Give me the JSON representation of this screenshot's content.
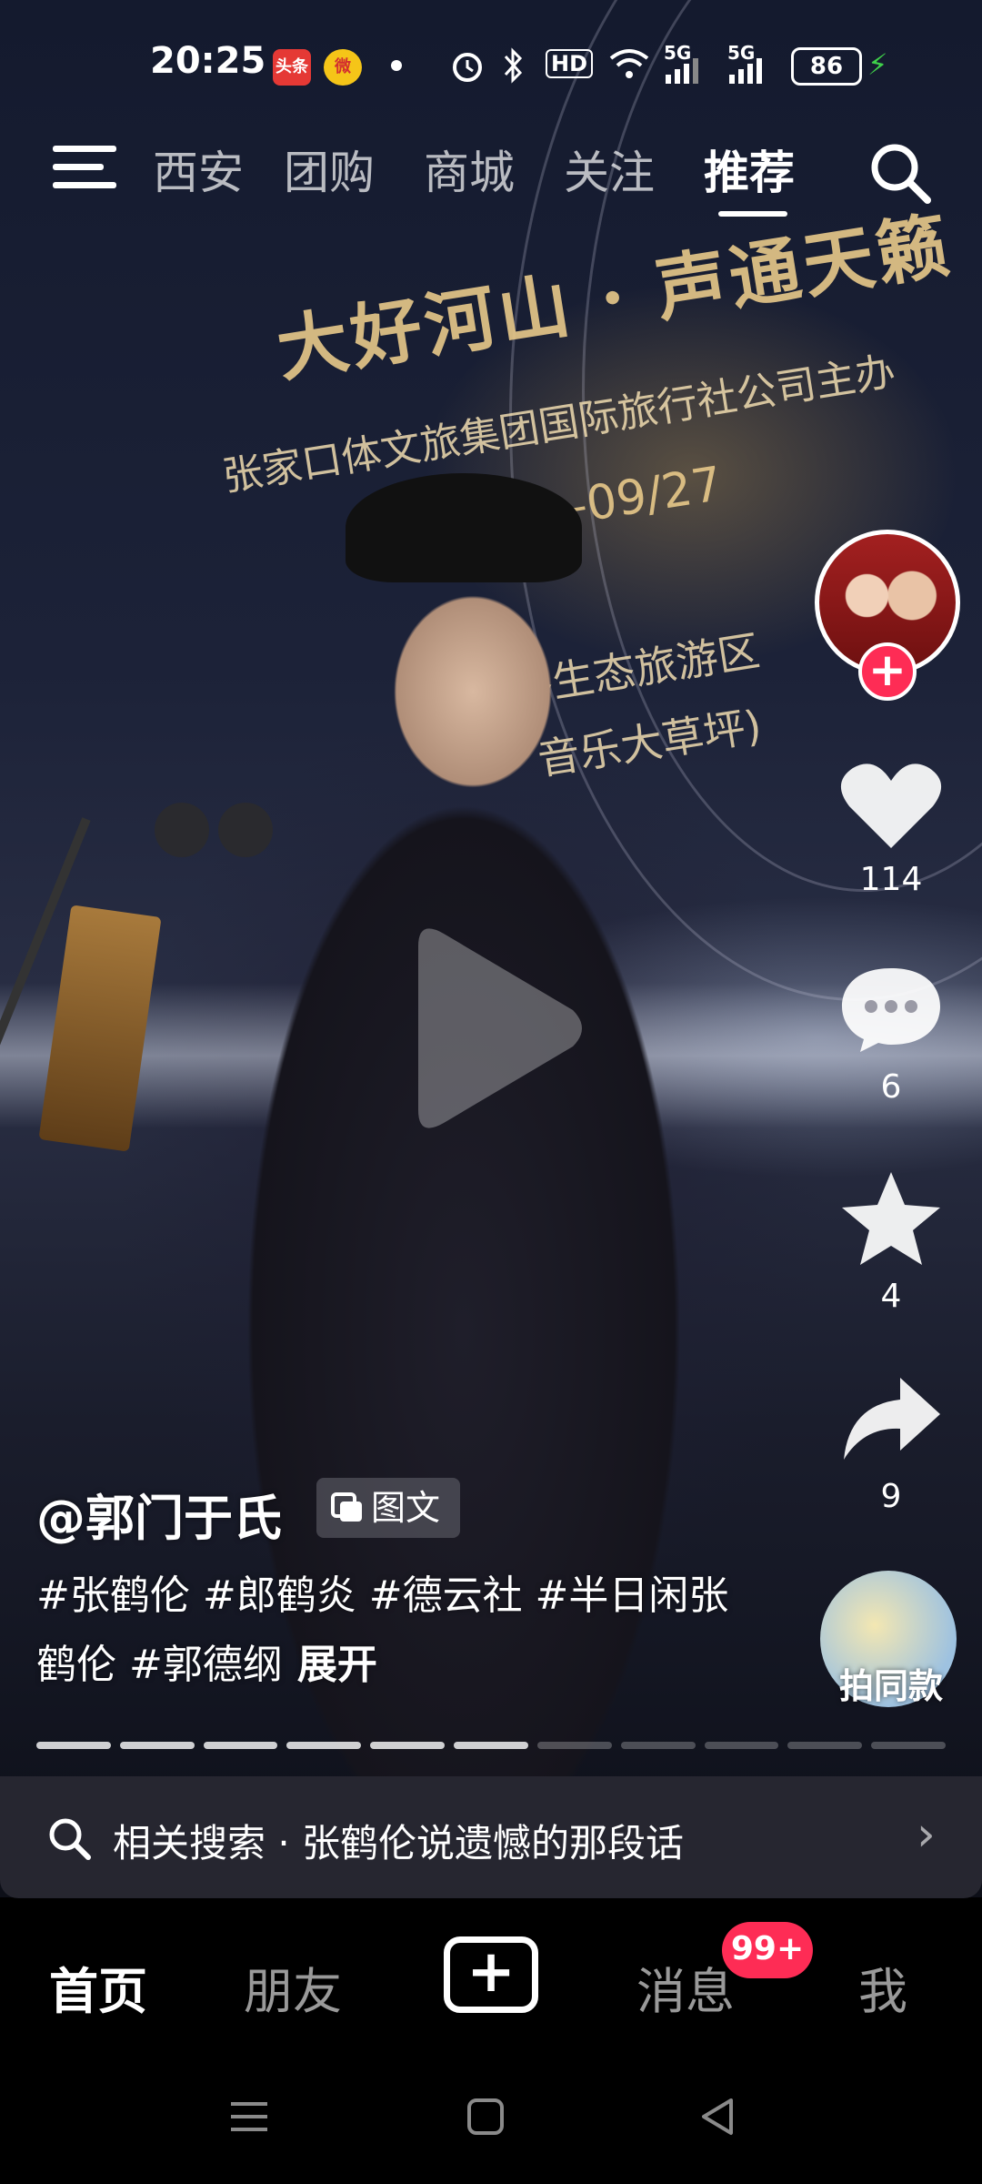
{
  "status_bar": {
    "time": "20:25",
    "notification_apps": [
      {
        "name": "toutiao-app-icon",
        "label": "头条",
        "color": "#e53935"
      },
      {
        "name": "weibo-app-icon",
        "label": "微",
        "color": "#f5c518"
      }
    ],
    "network_1": "5G",
    "network_2": "5G",
    "hd_label": "HD",
    "battery_level": "86",
    "charging_color": "#3fd04a"
  },
  "top_nav": {
    "tabs": [
      {
        "label": "西安",
        "active": false
      },
      {
        "label": "团购",
        "active": false
      },
      {
        "label": "商城",
        "active": false
      },
      {
        "label": "关注",
        "active": false
      },
      {
        "label": "推荐",
        "active": true
      }
    ]
  },
  "background_text": {
    "headline": "大好河山 · 声通天籁",
    "organizer": "张家口体文旅集团国际旅行社公司主办",
    "date": "6—09/27",
    "location": "谷生态旅游区",
    "venue": "音乐大草坪)"
  },
  "right_rail": {
    "likes": "114",
    "comments": "6",
    "favorites": "4",
    "shares": "9",
    "same_style_label": "拍同款"
  },
  "caption": {
    "author": "@郭门于氏",
    "content_type": "图文",
    "text": "#张鹤伦 #郎鹤炎 #德云社 #半日闲张鹤伦 #郭德纲",
    "expand_label": "展开"
  },
  "progress": {
    "total_segments": 11,
    "completed_segments": 6
  },
  "related_search": {
    "text": "相关搜索 · 张鹤伦说遗憾的那段话"
  },
  "bottom_nav": {
    "home": "首页",
    "friends": "朋友",
    "create": "+",
    "messages": "消息",
    "messages_badge": "99+",
    "me": "我"
  },
  "colors": {
    "accent": "#fe2c55"
  }
}
